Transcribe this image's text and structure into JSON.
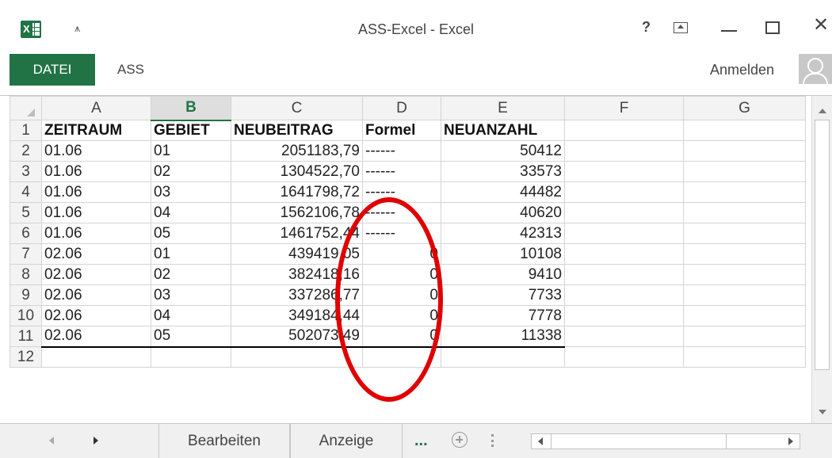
{
  "window": {
    "title": "ASS-Excel - Excel",
    "qat_glyph": "⩚",
    "help_glyph": "?",
    "close_glyph": "✕",
    "app_icon": "excel-icon",
    "logo_letter": "X"
  },
  "ribbon": {
    "tabs": [
      "DATEI",
      "ASS"
    ],
    "sign_in": "Anmelden",
    "accent_color": "#217346"
  },
  "sheet": {
    "column_headers": [
      "A",
      "B",
      "C",
      "D",
      "E",
      "F",
      "G"
    ],
    "selected_column": "B",
    "row_numbers": [
      "1",
      "2",
      "3",
      "4",
      "5",
      "6",
      "7",
      "8",
      "9",
      "10",
      "11",
      "12"
    ],
    "table_headers": [
      "ZEITRAUM",
      "GEBIET",
      "NEUBEITRAG",
      "Formel",
      "NEUANZAHL"
    ],
    "rows": [
      [
        "01.06",
        "01",
        "2051183,79",
        "------",
        "50412"
      ],
      [
        "01.06",
        "02",
        "1304522,70",
        "------",
        "33573"
      ],
      [
        "01.06",
        "03",
        "1641798,72",
        "------",
        "44482"
      ],
      [
        "01.06",
        "04",
        "1562106,78",
        "------",
        "40620"
      ],
      [
        "01.06",
        "05",
        "1461752,44",
        "------",
        "42313"
      ],
      [
        "02.06",
        "01",
        "439419,05",
        "0",
        "10108"
      ],
      [
        "02.06",
        "02",
        "382418,16",
        "0",
        "9410"
      ],
      [
        "02.06",
        "03",
        "337286,77",
        "0",
        "7733"
      ],
      [
        "02.06",
        "04",
        "349184,44",
        "0",
        "7778"
      ],
      [
        "02.06",
        "05",
        "502073,49",
        "0",
        "11338"
      ]
    ],
    "annotation": {
      "shape": "ellipse",
      "color": "#e00000",
      "target_column": "D"
    }
  },
  "sheet_tabs": {
    "tabs": [
      "Bearbeiten",
      "Anzeige"
    ],
    "more": "...",
    "icons": [
      "tab-prev-icon",
      "tab-next-icon",
      "add-sheet-icon",
      "split-handle-icon"
    ]
  }
}
